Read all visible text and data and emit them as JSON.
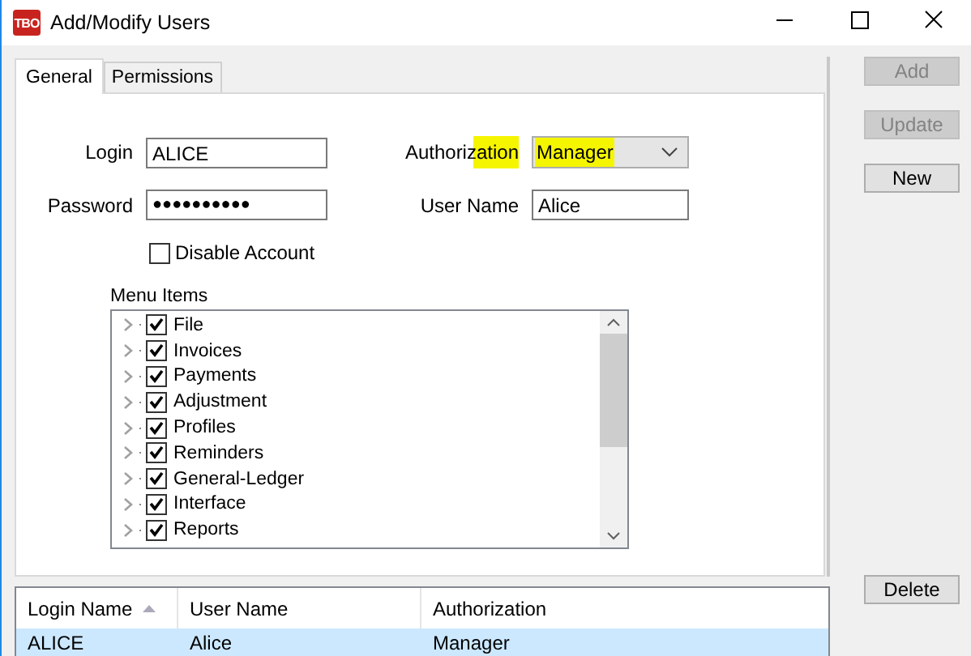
{
  "window": {
    "title": "Add/Modify Users",
    "app_icon_text": "TBO"
  },
  "tabs": [
    {
      "label": "General",
      "selected": true
    },
    {
      "label": "Permissions",
      "selected": false
    }
  ],
  "form": {
    "login": {
      "label": "Login",
      "value": "ALICE"
    },
    "password": {
      "label": "Password",
      "value": "●●●●●●●●●●"
    },
    "authorization": {
      "label": "Authorization",
      "value": "Manager",
      "highlighted": true
    },
    "user_name": {
      "label": "User Name",
      "value": "Alice"
    },
    "disable_account": {
      "label": "Disable Account",
      "checked": false
    }
  },
  "menu_items": {
    "label": "Menu Items",
    "items": [
      {
        "label": "File",
        "checked": true
      },
      {
        "label": "Invoices",
        "checked": true
      },
      {
        "label": "Payments",
        "checked": true
      },
      {
        "label": "Adjustment",
        "checked": true
      },
      {
        "label": "Profiles",
        "checked": true
      },
      {
        "label": "Reminders",
        "checked": true
      },
      {
        "label": "General-Ledger",
        "checked": true
      },
      {
        "label": "Interface",
        "checked": true
      },
      {
        "label": "Reports",
        "checked": true
      }
    ]
  },
  "buttons": [
    {
      "label": "Add",
      "disabled": true
    },
    {
      "label": "Update",
      "disabled": true
    },
    {
      "label": "New",
      "disabled": false
    }
  ],
  "delete_button": {
    "label": "Delete",
    "disabled": false
  },
  "users_table": {
    "columns": [
      {
        "label": "Login Name",
        "sorted": true
      },
      {
        "label": "User Name",
        "sorted": false
      },
      {
        "label": "Authorization",
        "sorted": false
      }
    ],
    "rows": [
      {
        "cells": [
          "ALICE",
          "Alice",
          "Manager"
        ],
        "selected": true
      }
    ]
  }
}
